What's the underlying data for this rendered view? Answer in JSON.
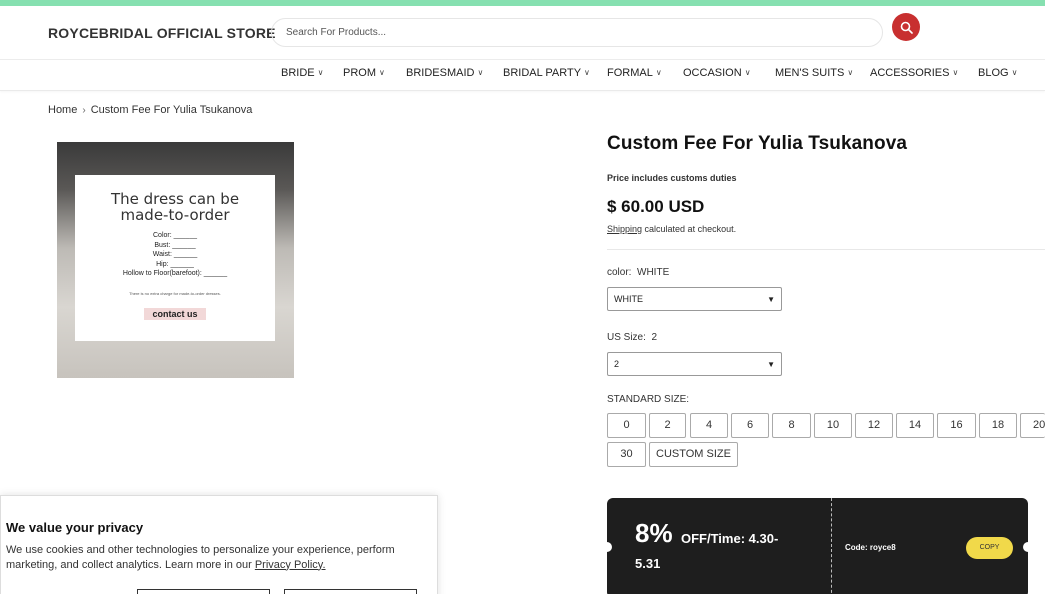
{
  "colors": {
    "top_bar": "#86e0b0",
    "search_button": "#c82f2f",
    "promo_bg": "#1e1e1e",
    "copy_button": "#f1d94a"
  },
  "header": {
    "store_name": "ROYCEBRIDAL OFFICIAL STORE",
    "search_placeholder": "Search For Products...",
    "search_icon": "search-icon"
  },
  "nav": {
    "items": [
      {
        "label": "BRIDE"
      },
      {
        "label": "PROM"
      },
      {
        "label": "BRIDESMAID"
      },
      {
        "label": "BRIDAL PARTY"
      },
      {
        "label": "FORMAL"
      },
      {
        "label": "OCCASION"
      },
      {
        "label": "MEN'S SUITS"
      },
      {
        "label": "ACCESSORIES"
      },
      {
        "label": "BLOG"
      }
    ]
  },
  "breadcrumb": {
    "home": "Home",
    "current": "Custom Fee For Yulia Tsukanova"
  },
  "image_card": {
    "title_line1": "The dress can be",
    "title_line2": "made-to-order",
    "fields": [
      "Color: ______",
      "Bust: ______",
      "Waist: ______",
      "Hip: ______",
      "Hollow to Floor(barefoot): ______"
    ],
    "note": "There is no extra charge for made-to-order dresses.",
    "button": "contact us"
  },
  "product": {
    "title": "Custom Fee For Yulia Tsukanova",
    "duties": "Price includes customs duties",
    "price": "$ 60.00 USD",
    "shipping_link": "Shipping",
    "shipping_rest": " calculated at checkout.",
    "color_label": "color:",
    "color_value": "WHITE",
    "color_select": "WHITE",
    "size_label": "US Size:",
    "size_value": "2",
    "size_select": "2",
    "standard_label": "STANDARD SIZE:",
    "sizes_row1": [
      "0",
      "2",
      "4",
      "6",
      "8",
      "10",
      "12",
      "14",
      "16",
      "18",
      "20"
    ],
    "sizes_row2": [
      "30",
      "CUSTOM SIZE"
    ]
  },
  "promo": {
    "percent": "8%",
    "off_line1": "OFF/Time: 4.30-",
    "off_line2": "5.31",
    "code": "Code: royce8",
    "copy": "COPY"
  },
  "privacy": {
    "title": "We value your privacy",
    "text": "We use cookies and other technologies to personalize your experience, perform marketing, and collect analytics. Learn more in our ",
    "link": "Privacy Policy."
  }
}
